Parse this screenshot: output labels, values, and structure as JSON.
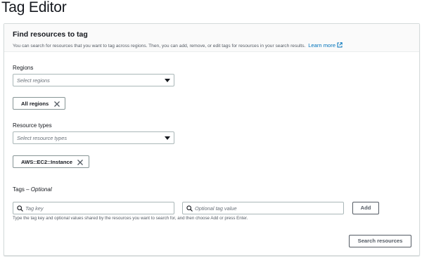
{
  "page": {
    "title": "Tag Editor"
  },
  "panel": {
    "heading": "Find resources to tag",
    "description": "You can search for resources that you want to tag across regions. Then, you can add, remove, or edit tags for resources in your search results.",
    "learn_more": "Learn more"
  },
  "regions": {
    "label": "Regions",
    "placeholder": "Select regions",
    "tokens": [
      "All regions"
    ]
  },
  "resource_types": {
    "label": "Resource types",
    "placeholder": "Select resource types",
    "tokens": [
      "AWS::EC2::Instance"
    ]
  },
  "tags": {
    "label": "Tags – ",
    "optional": "Optional",
    "key_placeholder": "Tag key",
    "value_placeholder": "Optional tag value",
    "add_label": "Add",
    "hint": "Type the tag key and optional values shared by the resources you want to search for, and then choose Add or press Enter."
  },
  "search_button": "Search resources",
  "colors": {
    "link": "#0073bb",
    "border": "#aab7b8",
    "text": "#16191f",
    "muted": "#545b64"
  }
}
